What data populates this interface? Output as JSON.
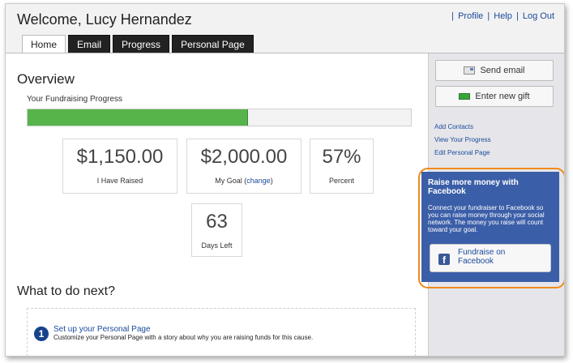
{
  "header": {
    "welcome": "Welcome, Lucy Hernandez",
    "links": {
      "profile": "Profile",
      "help": "Help",
      "logout": "Log Out",
      "separator": "|"
    }
  },
  "tabs": [
    {
      "label": "Home",
      "active": true
    },
    {
      "label": "Email",
      "active": false
    },
    {
      "label": "Progress",
      "active": false
    },
    {
      "label": "Personal Page",
      "active": false
    }
  ],
  "overview": {
    "title": "Overview",
    "progress_label": "Your Fundraising Progress",
    "progress_fraction": 0.575,
    "stats": {
      "raised_value": "$1,150.00",
      "raised_label": "I Have Raised",
      "goal_value": "$2,000.00",
      "goal_label": "My Goal (",
      "goal_change": "change",
      "goal_suffix": ")",
      "percent_value": "57%",
      "percent_label": "Percent",
      "days_value": "63",
      "days_label": "Days Left"
    }
  },
  "next": {
    "title": "What to do next?",
    "step_number": "1",
    "step_title": "Set up your Personal Page",
    "step_desc": "Customize your Personal Page with a story about why you are raising funds for this cause."
  },
  "sidebar": {
    "send_email": "Send email",
    "enter_gift": "Enter new gift",
    "links": [
      "Add Contacts",
      "View Your Progress",
      "Edit Personal Page"
    ],
    "facebook": {
      "title": "Raise more money with Facebook",
      "desc": "Connect your fundraiser to Facebook so you can raise money through your social network. The money you raise will count toward your goal.",
      "button_label": "Fundraise on Facebook",
      "logo_letter": "f"
    }
  },
  "colors": {
    "progress": "#57b44a",
    "facebook": "#3b5ea8",
    "highlight": "#f08a1a",
    "link": "#1a4a9c"
  }
}
